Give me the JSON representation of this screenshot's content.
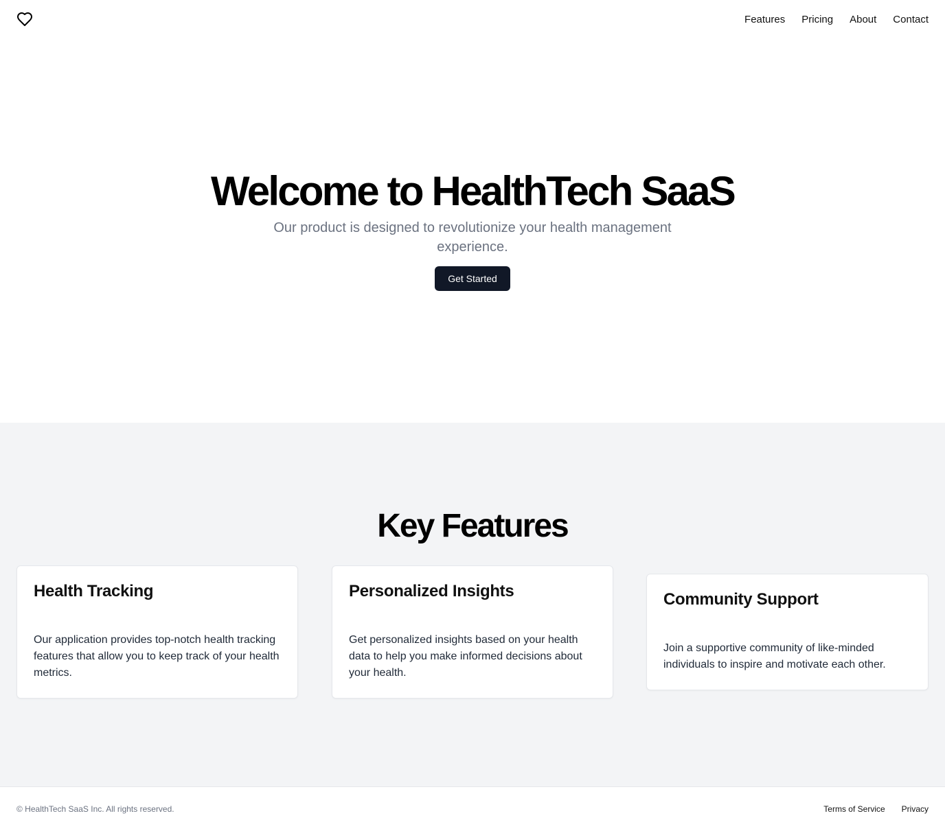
{
  "header": {
    "logo_icon": "heart-icon",
    "nav": [
      {
        "label": "Features"
      },
      {
        "label": "Pricing"
      },
      {
        "label": "About"
      },
      {
        "label": "Contact"
      }
    ]
  },
  "hero": {
    "title": "Welcome to HealthTech SaaS",
    "subtitle": "Our product is designed to revolutionize your health management experience.",
    "cta_label": "Get Started"
  },
  "features": {
    "title": "Key Features",
    "cards": [
      {
        "title": "Health Tracking",
        "text": "Our application provides top-notch health tracking features that allow you to keep track of your health metrics."
      },
      {
        "title": "Personalized Insights",
        "text": "Get personalized insights based on your health data to help you make informed decisions about your health."
      },
      {
        "title": "Community Support",
        "text": "Join a supportive community of like-minded individuals to inspire and motivate each other."
      }
    ]
  },
  "footer": {
    "copyright": "© HealthTech SaaS Inc. All rights reserved.",
    "links": [
      {
        "label": "Terms of Service"
      },
      {
        "label": "Privacy"
      }
    ]
  },
  "colors": {
    "button_bg": "#111827",
    "features_bg": "#f3f4f6",
    "muted_text": "#6b7280"
  }
}
